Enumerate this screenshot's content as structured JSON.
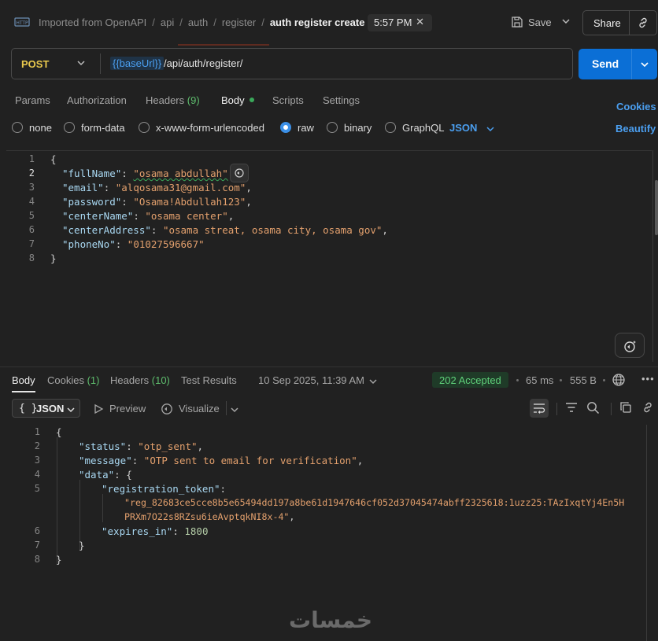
{
  "header": {
    "breadcrumbs": [
      "Imported from OpenAPI",
      "api",
      "auth",
      "register"
    ],
    "current": "auth register create",
    "time": "5:57 PM",
    "save_label": "Save",
    "share_label": "Share"
  },
  "request": {
    "method": "POST",
    "url_variable": "{{baseUrl}}",
    "url_path": "/api/auth/register/",
    "send_label": "Send",
    "tabs": [
      {
        "label": "Params"
      },
      {
        "label": "Authorization"
      },
      {
        "label": "Headers",
        "count": "(9)"
      },
      {
        "label": "Body",
        "active": true
      },
      {
        "label": "Scripts"
      },
      {
        "label": "Settings"
      }
    ],
    "cookies_label": "Cookies",
    "beautify_label": "Beautify",
    "body_types": [
      "none",
      "form-data",
      "x-www-form-urlencoded",
      "raw",
      "binary",
      "GraphQL"
    ],
    "selected_body_type": "raw",
    "format": "JSON",
    "body_lines": {
      "l1": "{",
      "fullName_key": "\"fullName\"",
      "fullName_val": "\"osama abdullah\"",
      "email_key": "\"email\"",
      "email_val": "\"alqosama31@gmail.com\"",
      "password_key": "\"password\"",
      "password_val": "\"Osama!Abdullah123\"",
      "centerName_key": "\"centerName\"",
      "centerName_val": "\"osama center\"",
      "centerAddress_key": "\"centerAddress\"",
      "centerAddress_val": "\"osama streat, osama city, osama gov\"",
      "phoneNo_key": "\"phoneNo\"",
      "phoneNo_val": "\"01027596667\"",
      "l8": "}"
    }
  },
  "response": {
    "tabs": [
      {
        "label": "Body",
        "active": true
      },
      {
        "label": "Cookies",
        "count": "(1)"
      },
      {
        "label": "Headers",
        "count": "(10)"
      },
      {
        "label": "Test Results"
      }
    ],
    "timestamp": "10 Sep 2025, 11:39 AM",
    "status": "202 Accepted",
    "time": "65 ms",
    "size": "555 B",
    "more": "•••",
    "format": "JSON",
    "preview_label": "Preview",
    "visualize_label": "Visualize",
    "body": {
      "open": "{",
      "status_key": "\"status\"",
      "status_val": "\"otp_sent\"",
      "message_key": "\"message\"",
      "message_val": "\"OTP sent to email for verification\"",
      "data_key": "\"data\"",
      "token_key": "\"registration_token\"",
      "token_val_1": "\"reg_82683ce5cce8b5e65494dd197a8be61d1947646cf052d37045474abff2325618:1uzz25:TAzIxqtYj4En5H",
      "token_val_2": "PRXm7O22s8RZsu6ieAvptqkNI8x-4\"",
      "expires_key": "\"expires_in\"",
      "expires_val": "1800",
      "inner_close": "}",
      "close": "}"
    }
  },
  "watermark": "خمسات",
  "colors": {
    "background": "#212121",
    "accent_blue": "#0b6fd6",
    "method_yellow": "#e8c84d",
    "status_green": "#5fd07a",
    "json_key": "#a9d8f2",
    "json_string": "#e3a06d"
  }
}
